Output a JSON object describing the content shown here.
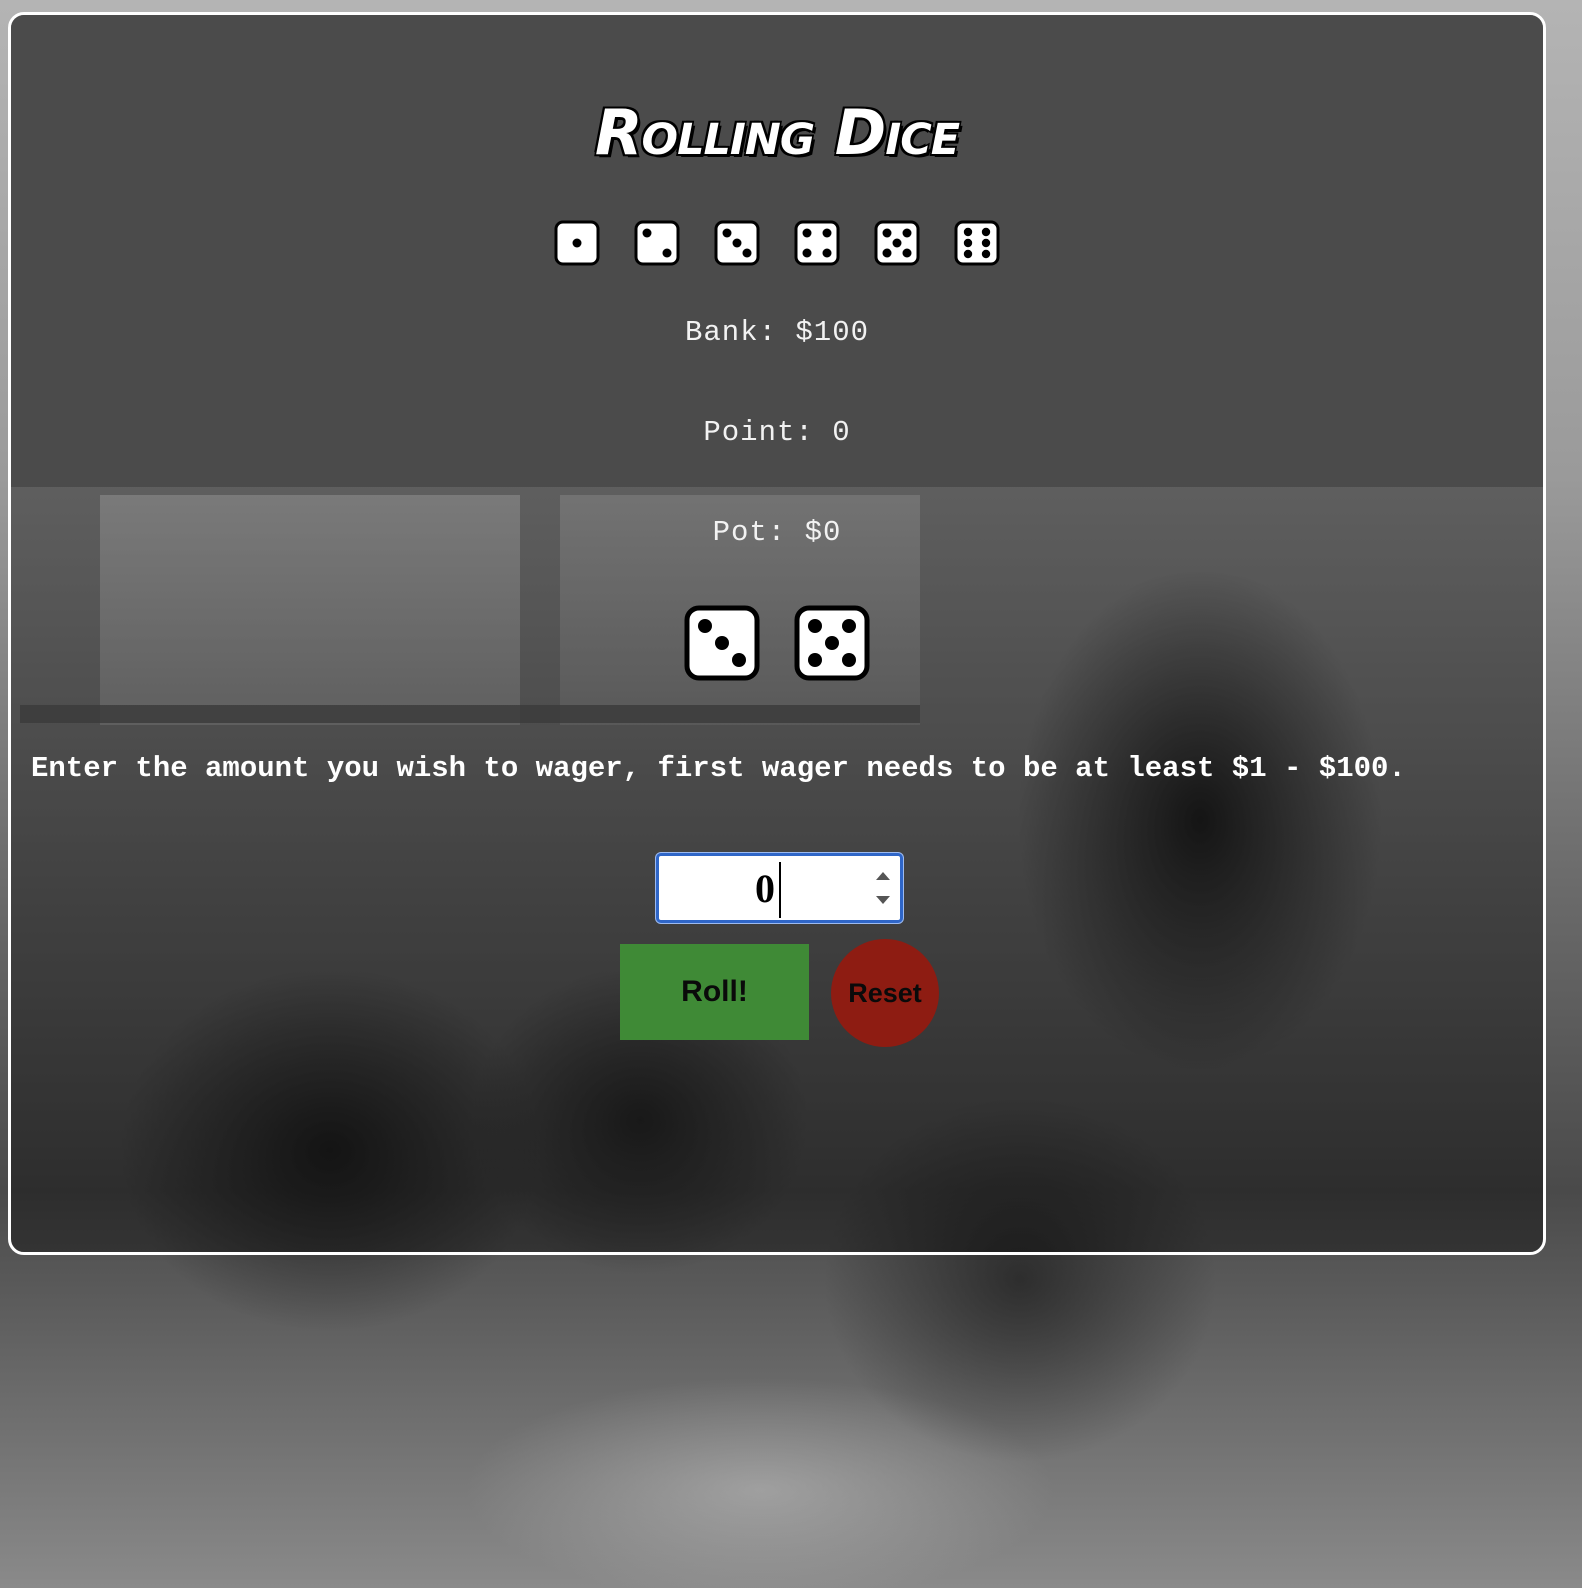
{
  "title": "Rolling Dice",
  "face_row": {
    "faces": [
      "die-one",
      "die-two",
      "die-three",
      "die-four",
      "die-five",
      "die-six"
    ]
  },
  "stats": {
    "bank": "Bank: $100",
    "point": "Point: 0",
    "pot": "Pot: $0"
  },
  "rolled_dice": [
    "die-three",
    "die-five"
  ],
  "prompt": "Enter the amount you wish to wager, first wager needs to be at least $1 - $100.",
  "wager": {
    "value": "0"
  },
  "buttons": {
    "roll": "Roll!",
    "reset": "Reset"
  },
  "colors": {
    "header_bg": "#4b4b4b",
    "roll_button": "#3f8a36",
    "reset_button": "#8e1c12",
    "input_focus": "#2f66c8"
  }
}
